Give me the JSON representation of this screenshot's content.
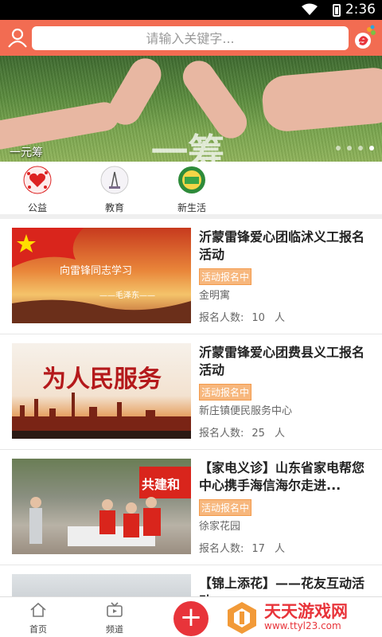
{
  "status": {
    "time": "2:36"
  },
  "search": {
    "placeholder": "请输入关键字..."
  },
  "banner": {
    "caption": "一元筹",
    "watermark": "一筹",
    "active_dot": 3
  },
  "categories": [
    {
      "label": "公益"
    },
    {
      "label": "教育"
    },
    {
      "label": "新生活"
    }
  ],
  "items": [
    {
      "title": "沂蒙雷锋爱心团临沭义工报名活动",
      "badge": "活动报名中",
      "place": "金明寓",
      "count_label": "报名人数:",
      "count": "10",
      "unit": "人",
      "thumb_text": "向雷锋同志学习",
      "thumb_sub": "——毛泽东——"
    },
    {
      "title": "沂蒙雷锋爱心团费县义工报名活动",
      "badge": "活动报名中",
      "place": "新庄镇便民服务中心",
      "count_label": "报名人数:",
      "count": "25",
      "unit": "人",
      "thumb_text": "为人民服务"
    },
    {
      "title": "【家电义诊】山东省家电帮您中心携手海信海尔走进...",
      "badge": "活动报名中",
      "place": "徐家花园",
      "count_label": "报名人数:",
      "count": "17",
      "unit": "人",
      "thumb_text": "共建和"
    },
    {
      "title": "【锦上添花】——花友互动活动"
    }
  ],
  "bottom_nav": {
    "home": "首页",
    "channel": "频道"
  },
  "watermark": {
    "name": "天天游戏网",
    "url": "www.ttyl23.com"
  }
}
